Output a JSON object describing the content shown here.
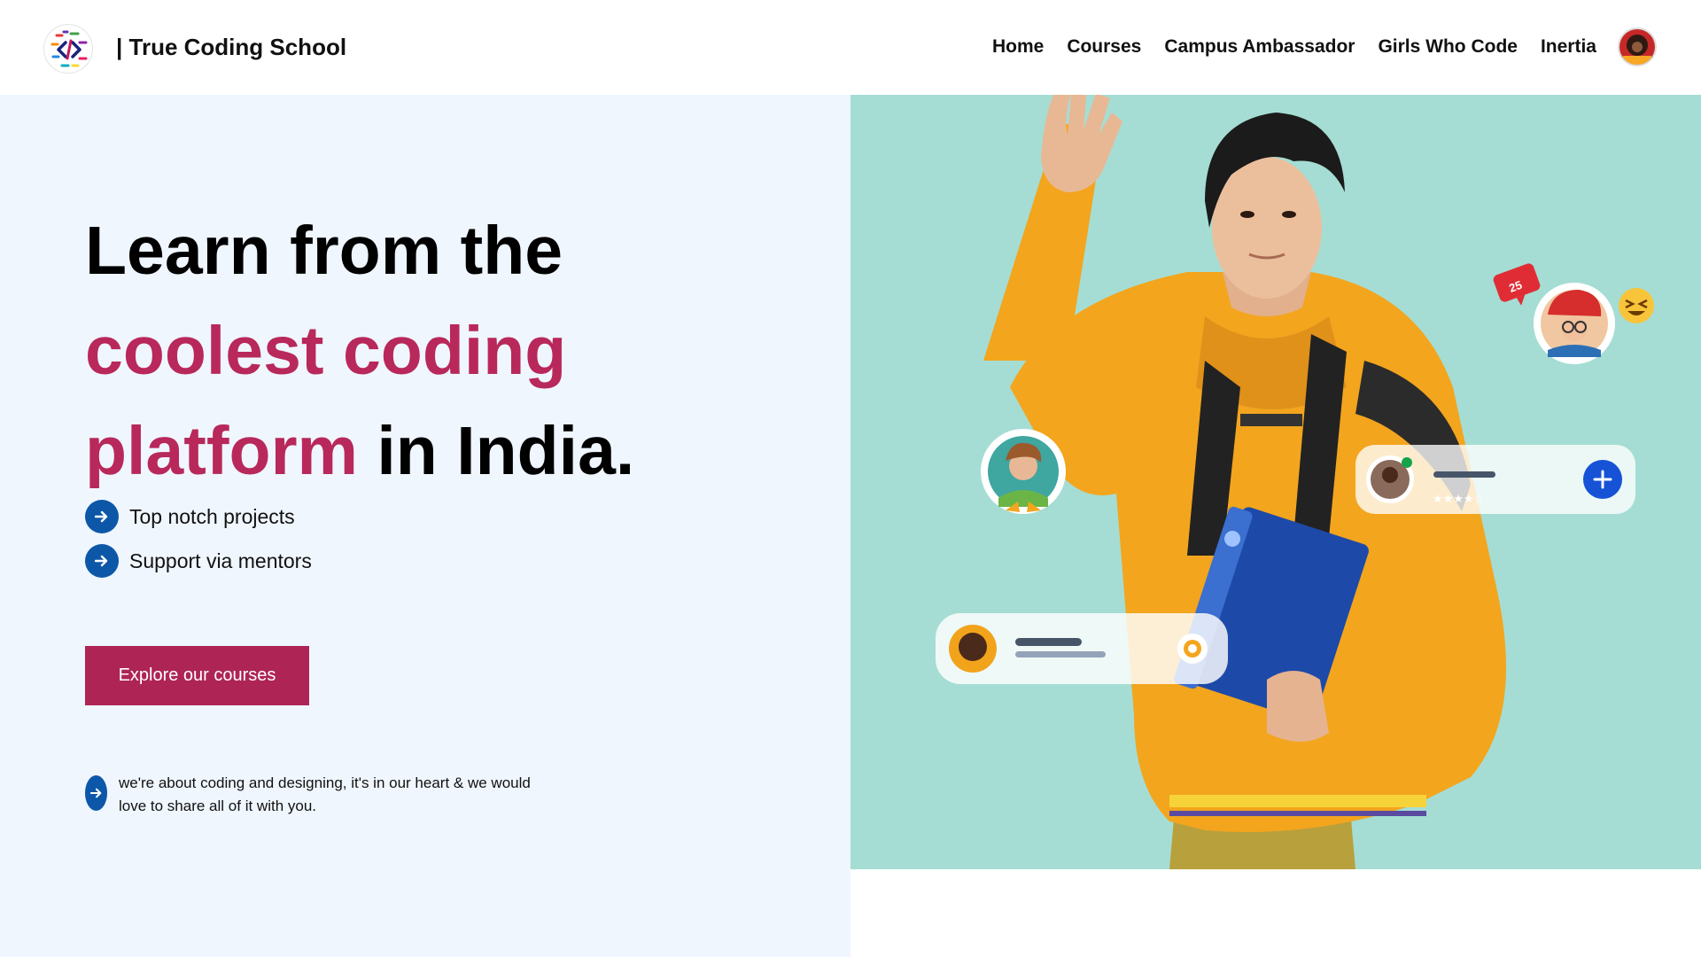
{
  "header": {
    "brand": "| True Coding School",
    "nav": [
      "Home",
      "Courses",
      "Campus Ambassador",
      "Girls Who Code",
      "Inertia"
    ]
  },
  "hero": {
    "headline_line1": "Learn from the",
    "headline_accent1": "coolest coding",
    "headline_accent2": "platform",
    "headline_end": " in India.",
    "features": [
      "Top notch projects",
      "Support via mentors"
    ],
    "cta": "Explore our courses",
    "tagline": "we're about coding and designing, it's in our heart & we would love to share all of it with you."
  },
  "illustration": {
    "likes_badge": "25",
    "rating_stars": "★★★★☆"
  },
  "colors": {
    "accent": "#b8285b",
    "cta": "#ae2455",
    "bullet": "#0d57a8",
    "left_bg": "#eff6fe",
    "right_bg": "#a5ddd4",
    "hoodie": "#f3a51e"
  }
}
